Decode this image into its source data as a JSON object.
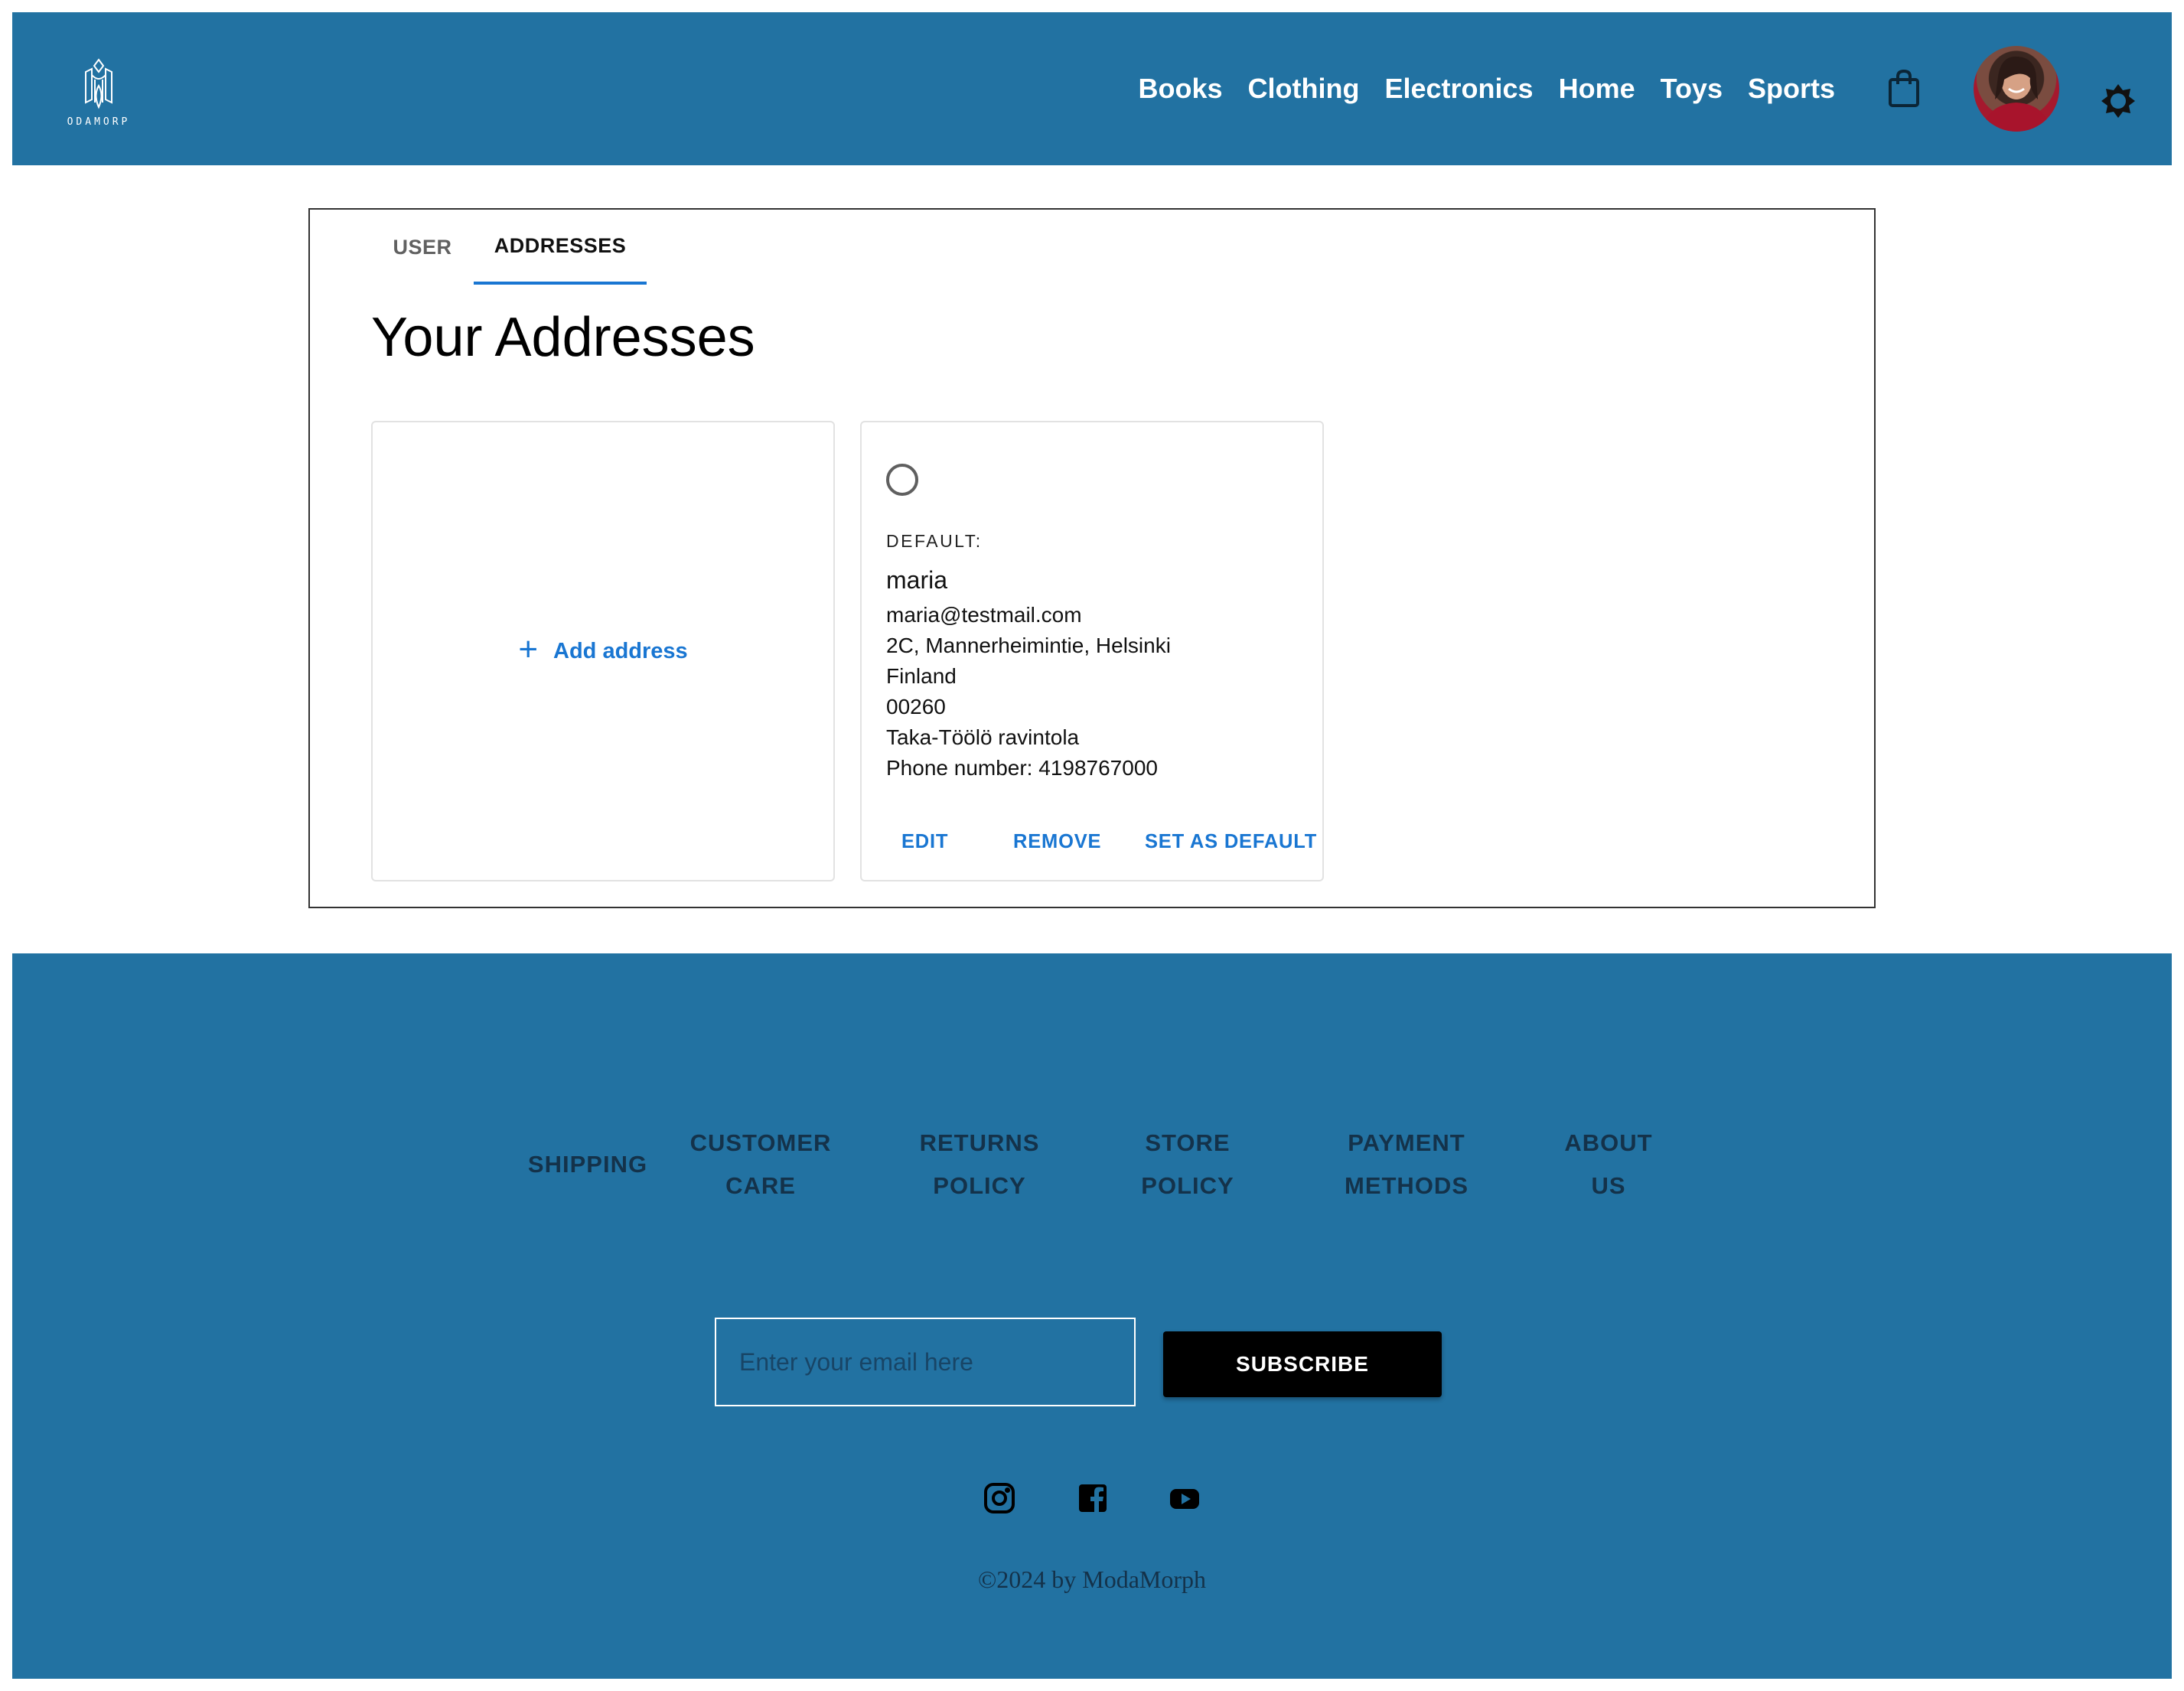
{
  "header": {
    "logo_text": "ODAMORP",
    "nav": [
      "Books",
      "Clothing",
      "Electronics",
      "Home",
      "Toys",
      "Sports"
    ],
    "icons": {
      "cart": "shopping-bag-icon",
      "avatar": "user-avatar",
      "theme": "brightness-icon"
    }
  },
  "tabs": [
    {
      "label": "USER",
      "active": false
    },
    {
      "label": "ADDRESSES",
      "active": true
    }
  ],
  "page": {
    "title": "Your Addresses"
  },
  "add_card": {
    "icon": "+",
    "label": "Add address"
  },
  "address_card": {
    "default_label": "DEFAULT:",
    "name": "maria",
    "email": "maria@testmail.com",
    "street": "2C, Mannerheimintie, Helsinki",
    "country": "Finland",
    "postal_code": "00260",
    "company": "Taka-Töölö ravintola",
    "phone": "Phone number: 4198767000",
    "actions": {
      "edit": "EDIT",
      "remove": "REMOVE",
      "set_default": "SET AS DEFAULT"
    }
  },
  "footer": {
    "links": [
      {
        "line1": "SHIPPING",
        "line2": ""
      },
      {
        "line1": "CUSTOMER",
        "line2": "CARE"
      },
      {
        "line1": "RETURNS",
        "line2": "POLICY"
      },
      {
        "line1": "STORE",
        "line2": "POLICY"
      },
      {
        "line1": "PAYMENT",
        "line2": "METHODS"
      },
      {
        "line1": "ABOUT",
        "line2": "US"
      }
    ],
    "email_placeholder": "Enter your email here",
    "subscribe_label": "SUBSCRIBE",
    "social": [
      "instagram-icon",
      "facebook-icon",
      "youtube-icon"
    ],
    "copyright": "©2024 by ModaMorph"
  },
  "colors": {
    "brand_blue": "#2272a2",
    "accent": "#1976d2",
    "footer_text": "#14324a"
  }
}
